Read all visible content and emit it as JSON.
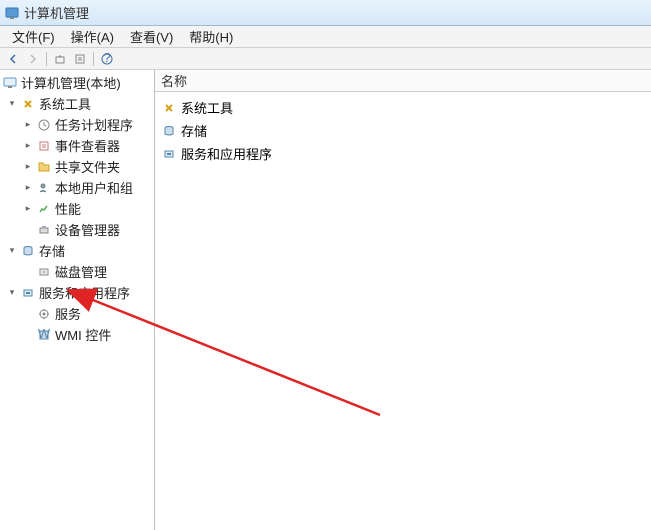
{
  "window": {
    "title": "计算机管理"
  },
  "menubar": {
    "file": "文件(F)",
    "action": "操作(A)",
    "view": "查看(V)",
    "help": "帮助(H)"
  },
  "tree": {
    "root": "计算机管理(本地)",
    "system_tools": "系统工具",
    "task_scheduler": "任务计划程序",
    "event_viewer": "事件查看器",
    "shared_folders": "共享文件夹",
    "local_users_groups": "本地用户和组",
    "performance": "性能",
    "device_manager": "设备管理器",
    "storage": "存储",
    "disk_management": "磁盘管理",
    "services_apps": "服务和应用程序",
    "services": "服务",
    "wmi_control": "WMI 控件"
  },
  "list": {
    "header_name": "名称",
    "items": [
      {
        "label": "系统工具",
        "icon": "tools"
      },
      {
        "label": "存储",
        "icon": "storage"
      },
      {
        "label": "服务和应用程序",
        "icon": "services"
      }
    ]
  },
  "toggles": {
    "expanded": "▾",
    "collapsed": "▸"
  }
}
